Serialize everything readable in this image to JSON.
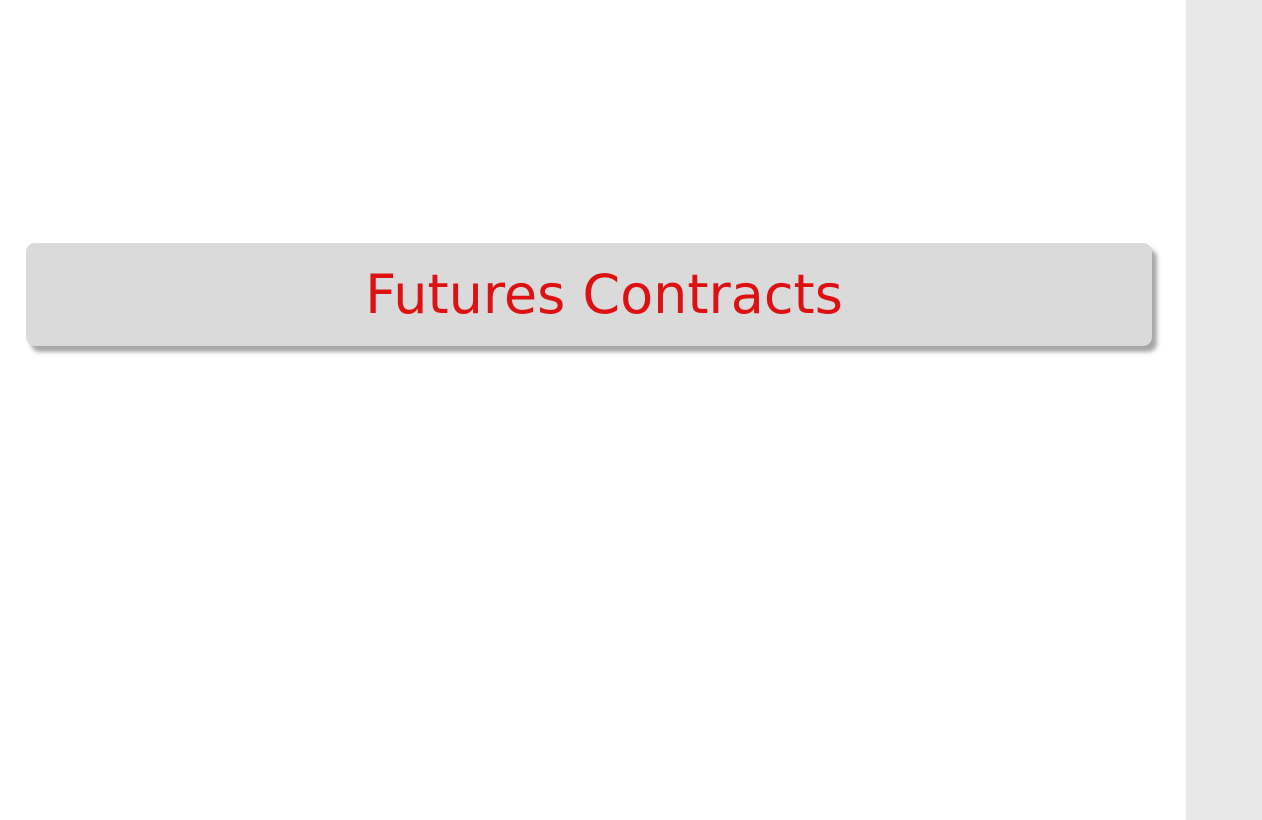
{
  "slide": {
    "title": "Futures Contracts",
    "title_color": "#dd1111",
    "title_box_color": "#dadada"
  },
  "side_panel": {
    "color": "#e8e8e8"
  }
}
